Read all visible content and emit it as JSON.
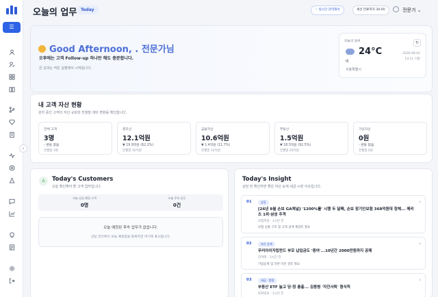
{
  "sidebar": {
    "active_button": "☰",
    "icons": [
      "users-icon",
      "user-check-icon",
      "grid-icon",
      "book-icon",
      "branch-icon",
      "diamond-icon",
      "clipboard-icon",
      "activity-icon",
      "target-icon",
      "flask-icon",
      "chat-icon",
      "chart-icon",
      "bulb-icon",
      "list-icon",
      "settings-icon",
      "logout-icon"
    ],
    "collapse": "›"
  },
  "header": {
    "title": "오늘의 업무",
    "badge": "Today",
    "fav_pill": "♡ 실시간 관리해서",
    "session_pill": "세션 만료까지 30:00",
    "user_name": "전문가 ⌄"
  },
  "hero": {
    "greeting": "Good Afternoon, . 전문가님",
    "line1": "오후에는 고객 Follow-up 하나만 해도 충분합니다.",
    "line2": "큰 성과는 작은 실행에서 시작됩니다."
  },
  "weather": {
    "label": "오늘의 날씨",
    "temp": "24°C",
    "condition": "비",
    "location": "서울특별시",
    "date": "2026.08.01",
    "time": "13:11 기준"
  },
  "assets": {
    "title": "내 고객 자산 현황",
    "subtitle": "관리 중인 고객의 자산 규모와 전월말 대비 변화를 확인합니다.",
    "cards": [
      {
        "label": "전체 고객",
        "value": "3명",
        "change": "- 변동 없음",
        "prev": "전월말 3명"
      },
      {
        "label": "총자산",
        "value": "12.1억원",
        "change": "▼ 19.9억원 (62.2%)",
        "prev": "전월말 32억원"
      },
      {
        "label": "금융자산",
        "value": "10.6억원",
        "change": "▼ 1.4억원 (11.7%)",
        "prev": "전월말 12억원"
      },
      {
        "label": "부동산",
        "value": "1.5억원",
        "change": "▼ 18.5억원 (92.5%)",
        "prev": "전월말 20억원"
      },
      {
        "label": "가상자산",
        "value": "0원",
        "change": "- 변동 없음",
        "prev": "전월말 0원"
      }
    ]
  },
  "customers": {
    "title": "Today's Customers",
    "subtitle": "오늘 확인해야 할 고객 업무입니다.",
    "stat1_label": "오늘 상담 예정 고객",
    "stat1_value": "0명",
    "stat2_label": "오늘 후속 업무",
    "stat2_value": "0건",
    "empty_title": "오늘 예정된 후속 업무가 없습니다.",
    "empty_sub": "상담 관리에서 오늘 예정일을 등록하면 여기에 표시됩니다."
  },
  "insight": {
    "title": "Today's Insight",
    "subtitle": "상담 전 확인하면 좋은 자산 승계·세금·시장 이슈입니다.",
    "items": [
      {
        "num": "01",
        "tag": "상증",
        "headline": "[26년 8월 손보 GA채널] '1200%룰' 시행 두 달째, 손보 장기인보험 368억원대 정체... 메리츠 1위·삼성 추격",
        "source": "보험저널 · 1시간 전",
        "desc": "보험 상품 구조 및 고객 설계 재검토 필요"
      },
      {
        "num": "02",
        "tag": "자산 승계",
        "headline": "우리아이자립펀드 부모 납입금도 '증여'...10년간 2000만원까지 공제",
        "source": "한겨레 · 1시간 전",
        "desc": "가업승계 및 자본 이전 검토 필요"
      },
      {
        "num": "03",
        "tag": "세금 · 법령",
        "headline": "부동산 ETF 늘고 당·정 총출... 김동범 '자진사퇴' 형식적",
        "source": "문화일보 · 1시간 전",
        "desc": ""
      }
    ]
  }
}
